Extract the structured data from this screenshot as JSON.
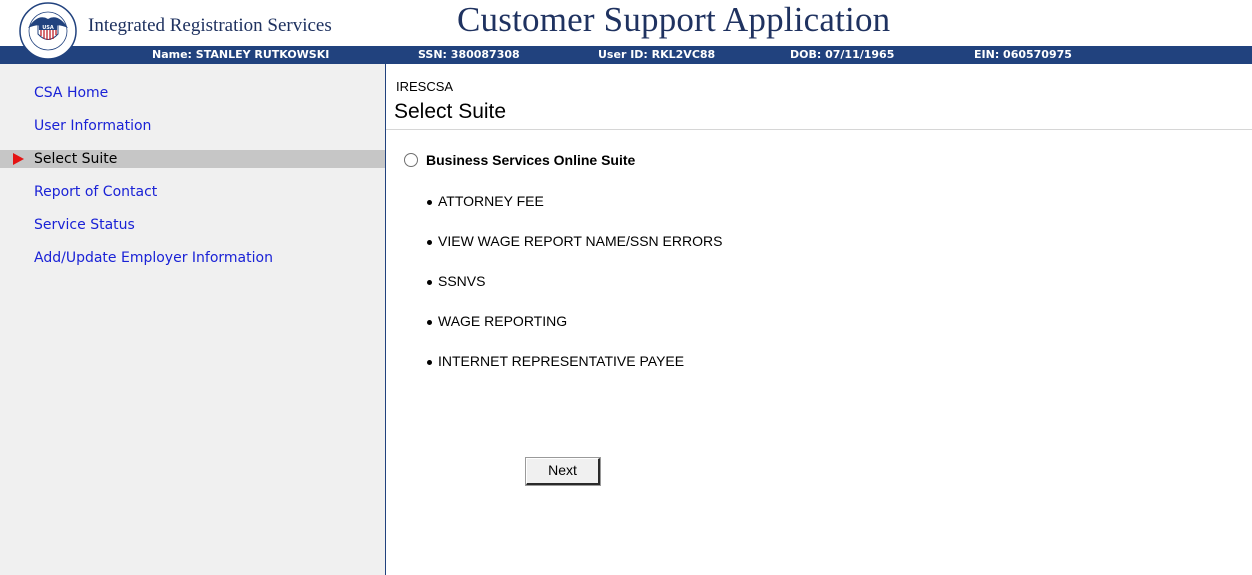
{
  "header": {
    "org_title": "Integrated Registration Services",
    "app_title": "Customer Support Application",
    "logo": {
      "icon": "ssa-seal-icon",
      "seal_text": "SOCIAL SECURITY ADMINISTRATION",
      "inner_text": "USA"
    }
  },
  "user_info": {
    "name": "Name: STANLEY RUTKOWSKI",
    "ssn": "SSN: 380087308",
    "user_id": "User ID: RKL2VC88",
    "dob": "DOB: 07/11/1965",
    "ein": "EIN: 060570975"
  },
  "sidebar": {
    "items": [
      {
        "label": "CSA Home",
        "active": false
      },
      {
        "label": "User Information",
        "active": false
      },
      {
        "label": "Select Suite",
        "active": true
      },
      {
        "label": "Report of Contact",
        "active": false
      },
      {
        "label": "Service Status",
        "active": false
      },
      {
        "label": "Add/Update Employer Information",
        "active": false
      }
    ],
    "active_indicator_icon": "red-arrow-icon"
  },
  "main": {
    "app_code": "IRESCSA",
    "page_title": "Select Suite",
    "suite": {
      "label": "Business Services Online Suite",
      "selected": false,
      "services": [
        "ATTORNEY FEE",
        "VIEW WAGE REPORT NAME/SSN ERRORS",
        "SSNVS",
        "WAGE REPORTING",
        "INTERNET REPRESENTATIVE PAYEE"
      ]
    },
    "next_label": "Next"
  },
  "colors": {
    "header_bar": "#21427e",
    "title_text": "#1f3260",
    "sidebar_bg": "#f0f0f0",
    "nav_link": "#1a22d6",
    "active_row": "#c6c6c6",
    "active_arrow": "#e41414"
  }
}
